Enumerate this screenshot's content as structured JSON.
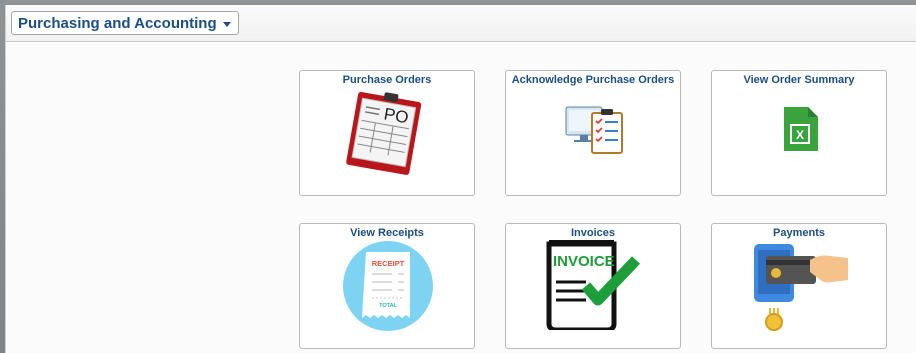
{
  "header": {
    "homepage_title": "Purchasing and Accounting"
  },
  "tiles": [
    {
      "title": "Purchase Orders",
      "icon": "purchase-order-clipboard-icon",
      "icon_text": "PO"
    },
    {
      "title": "Acknowledge Purchase Orders",
      "icon": "acknowledge-checklist-icon"
    },
    {
      "title": "View Order Summary",
      "icon": "excel-file-icon",
      "icon_text": "X"
    },
    {
      "title": "View Receipts",
      "icon": "receipt-icon",
      "icon_text": "RECEIPT",
      "icon_text_2": "TOTAL"
    },
    {
      "title": "Invoices",
      "icon": "invoice-checkmark-icon",
      "icon_text": "INVOICE"
    },
    {
      "title": "Payments",
      "icon": "card-payment-icon"
    }
  ],
  "colors": {
    "title_blue": "#1b4e84",
    "po_red": "#c4191e",
    "excel_green": "#3aa33e",
    "receipt_circle": "#7fd3f2",
    "invoice_green": "#1e9e3a"
  }
}
